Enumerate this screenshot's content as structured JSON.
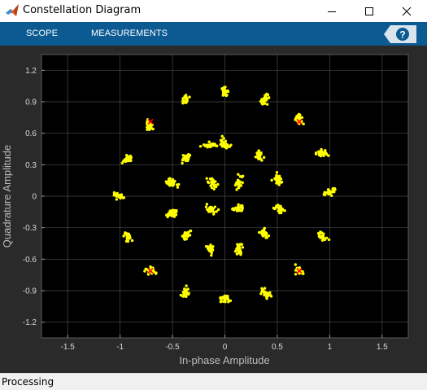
{
  "window": {
    "title": "Constellation Diagram",
    "icon": "matlab-icon",
    "controls": [
      "minimize-icon",
      "maximize-icon",
      "close-icon"
    ]
  },
  "toolstrip": {
    "items": [
      {
        "label": "SCOPE"
      },
      {
        "label": "MEASUREMENTS"
      }
    ],
    "help_icon": "help-icon",
    "color": "#0c5a92"
  },
  "status": {
    "text": "Processing"
  },
  "colors": {
    "background": "#000000",
    "points": "#ffff00",
    "reference": "#ff0000",
    "grid": "#4a4a4a"
  },
  "chart_data": {
    "type": "scatter",
    "title": "",
    "xlabel": "In-phase Amplitude",
    "ylabel": "Quadrature Amplitude",
    "xlim": [
      -1.75,
      1.75
    ],
    "ylim": [
      -1.35,
      1.35
    ],
    "xticks": [
      -1.5,
      -1,
      -0.5,
      0,
      0.5,
      1,
      1.5
    ],
    "xtick_labels": [
      "-1.5",
      "-1",
      "-0.5",
      "0",
      "0.5",
      "1",
      "1.5"
    ],
    "yticks": [
      1.2,
      0.9,
      0.6,
      0.3,
      0,
      -0.3,
      -0.6,
      -0.9,
      -1.2
    ],
    "ytick_labels": [
      "1.2",
      "0.9",
      "0.6",
      "0.3",
      "0",
      "-0.3",
      "-0.6",
      "-0.9",
      "-1.2"
    ],
    "grid": true,
    "series": [
      {
        "marker": "yellow-dots",
        "clusters": [
          {
            "x": 0.0,
            "y": 1.0
          },
          {
            "x": 0.38,
            "y": 0.92
          },
          {
            "x": 0.71,
            "y": 0.73
          },
          {
            "x": 0.92,
            "y": 0.41
          },
          {
            "x": 1.0,
            "y": 0.04
          },
          {
            "x": 0.92,
            "y": -0.38
          },
          {
            "x": 0.71,
            "y": -0.71
          },
          {
            "x": 0.38,
            "y": -0.92
          },
          {
            "x": 0.0,
            "y": -0.98
          },
          {
            "x": -0.38,
            "y": -0.92
          },
          {
            "x": -0.71,
            "y": -0.71
          },
          {
            "x": -0.92,
            "y": -0.39
          },
          {
            "x": -1.0,
            "y": 0.0
          },
          {
            "x": -0.93,
            "y": 0.35
          },
          {
            "x": -0.72,
            "y": 0.68
          },
          {
            "x": -0.38,
            "y": 0.92
          },
          {
            "x": 0.0,
            "y": 0.5
          },
          {
            "x": 0.33,
            "y": 0.39
          },
          {
            "x": 0.5,
            "y": 0.16
          },
          {
            "x": 0.52,
            "y": -0.12
          },
          {
            "x": 0.37,
            "y": -0.36
          },
          {
            "x": 0.14,
            "y": -0.5
          },
          {
            "x": -0.14,
            "y": -0.5
          },
          {
            "x": -0.36,
            "y": -0.37
          },
          {
            "x": -0.5,
            "y": -0.16
          },
          {
            "x": -0.51,
            "y": 0.13
          },
          {
            "x": -0.37,
            "y": 0.37
          },
          {
            "x": -0.15,
            "y": 0.49
          },
          {
            "x": 0.13,
            "y": 0.13
          },
          {
            "x": 0.13,
            "y": -0.12
          },
          {
            "x": -0.13,
            "y": -0.12
          },
          {
            "x": -0.13,
            "y": 0.13
          }
        ]
      },
      {
        "marker": "red-reference",
        "points": [
          {
            "x": 0.71,
            "y": 0.71
          },
          {
            "x": 0.71,
            "y": -0.71
          },
          {
            "x": -0.71,
            "y": -0.71
          },
          {
            "x": -0.71,
            "y": 0.71
          }
        ]
      }
    ]
  }
}
